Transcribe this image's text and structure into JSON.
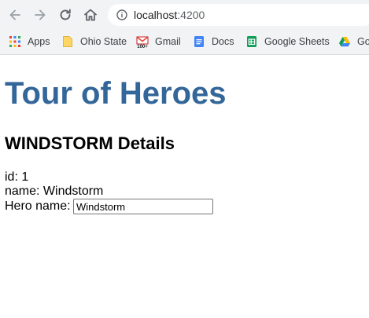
{
  "browser": {
    "url_host": "localhost",
    "url_port": ":4200",
    "bookmarks": [
      {
        "label": "Apps",
        "icon": "apps-grid-icon"
      },
      {
        "label": "Ohio State",
        "icon": "folder-icon"
      },
      {
        "label": "Gmail",
        "icon": "gmail-icon"
      },
      {
        "label": "Docs",
        "icon": "docs-icon"
      },
      {
        "label": "Google Sheets",
        "icon": "sheets-icon"
      },
      {
        "label": "Go",
        "icon": "drive-icon"
      }
    ]
  },
  "page": {
    "title": "Tour of Heroes",
    "details_heading": "WINDSTORM Details",
    "id_label": "id: ",
    "id_value": "1",
    "name_label": "name: ",
    "name_value": "Windstorm",
    "hero_name_label": "Hero name: ",
    "hero_name_value": "Windstorm"
  },
  "colors": {
    "title": "#336699",
    "chrome_bg": "#f1f3f4"
  }
}
